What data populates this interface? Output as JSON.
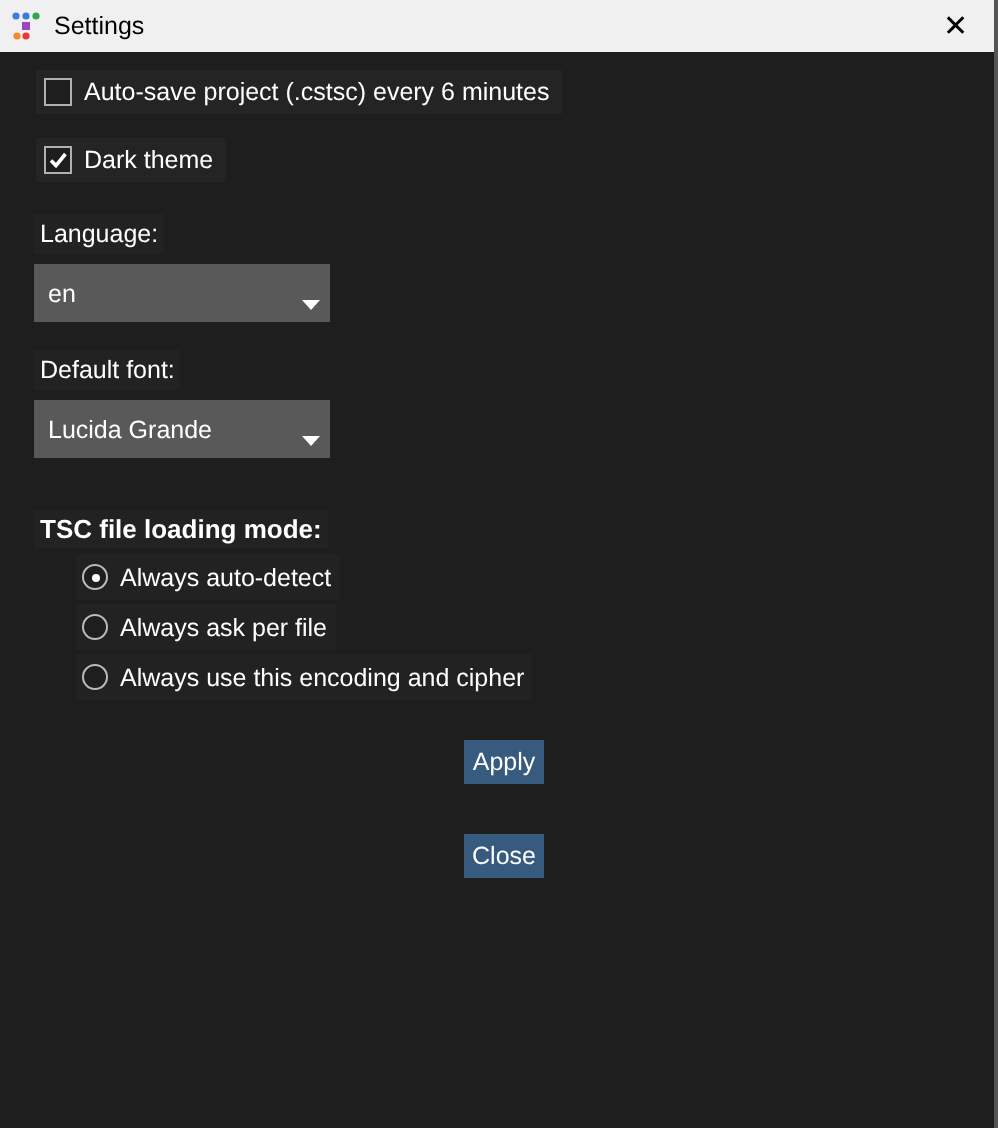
{
  "window": {
    "title": "Settings",
    "close": "✕"
  },
  "checkboxes": [
    {
      "label": "Auto-save project (.cstsc) every 6 minutes",
      "checked": false
    },
    {
      "label": "Dark theme",
      "checked": true
    }
  ],
  "dropdowns": [
    {
      "label": "Language:",
      "value": "en"
    },
    {
      "label": "Default font:",
      "value": "Lucida Grande"
    }
  ],
  "loading_mode": {
    "heading": "TSC file loading mode:",
    "options": [
      {
        "label": "Always auto-detect",
        "selected": true
      },
      {
        "label": "Always ask per file",
        "selected": false
      },
      {
        "label": "Always use this encoding and cipher",
        "selected": false
      }
    ]
  },
  "buttons": [
    {
      "label": "Apply"
    },
    {
      "label": "Close"
    }
  ]
}
